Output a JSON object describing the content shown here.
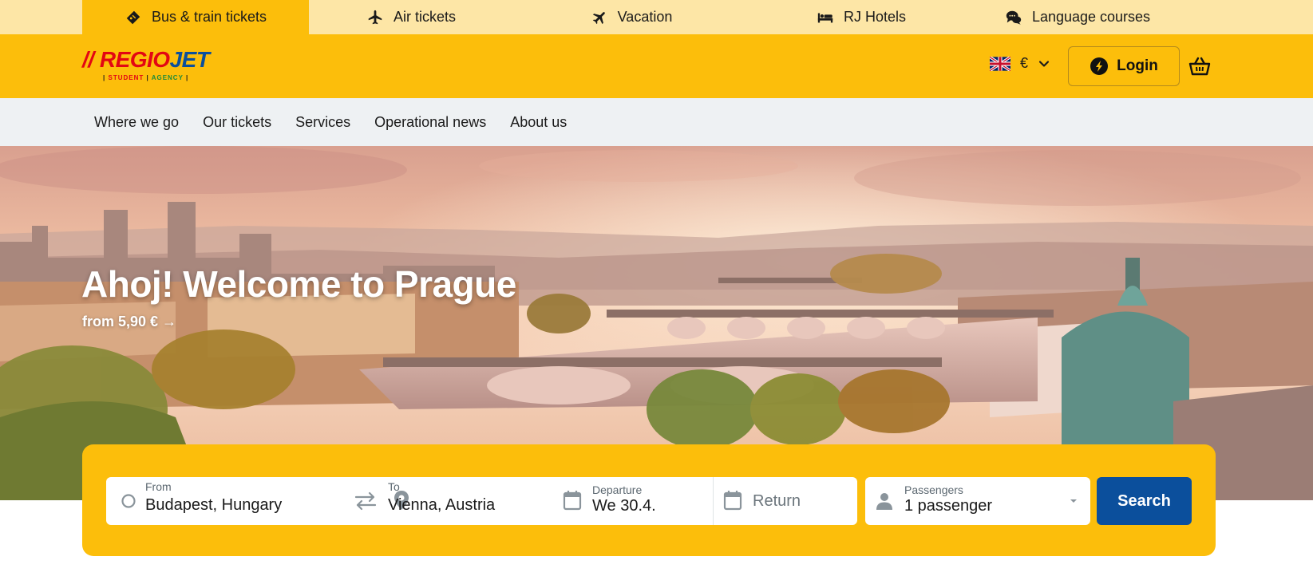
{
  "top_tabs": [
    {
      "label": "Bus & train tickets",
      "icon": "ticket-icon",
      "active": true
    },
    {
      "label": "Air tickets",
      "icon": "plane-icon",
      "active": false
    },
    {
      "label": "Vacation",
      "icon": "vacation-plane-icon",
      "active": false
    },
    {
      "label": "RJ Hotels",
      "icon": "bed-icon",
      "active": false
    },
    {
      "label": "Language courses",
      "icon": "chat-bubbles-icon",
      "active": false
    }
  ],
  "header": {
    "logo": {
      "bars": "//",
      "regio": "REGIO",
      "jet": "JET",
      "sub_student": "STUDENT",
      "sub_agency": "AGENCY"
    },
    "currency": "€",
    "language_icon": "uk-flag-icon",
    "login_label": "Login",
    "cart_icon": "basket-icon"
  },
  "nav": {
    "items": [
      "Where we go",
      "Our tickets",
      "Services",
      "Operational news",
      "About us"
    ]
  },
  "hero": {
    "title": "Ahoj! Welcome to Prague",
    "subtitle": "from 5,90 € →"
  },
  "search": {
    "from": {
      "label": "From",
      "value": "Budapest, Hungary"
    },
    "to": {
      "label": "To",
      "value": "Vienna, Austria"
    },
    "departure": {
      "label": "Departure",
      "value": "We 30.4."
    },
    "return": {
      "placeholder": "Return"
    },
    "passengers": {
      "label": "Passengers",
      "value": "1 passenger"
    },
    "button_label": "Search"
  },
  "colors": {
    "brand_yellow": "#fcbe0b",
    "top_strip": "#fde6a6",
    "nav_bg": "#eef1f3",
    "search_button": "#0b4f9c",
    "logo_red": "#e30613",
    "logo_blue": "#0b4f9c"
  }
}
